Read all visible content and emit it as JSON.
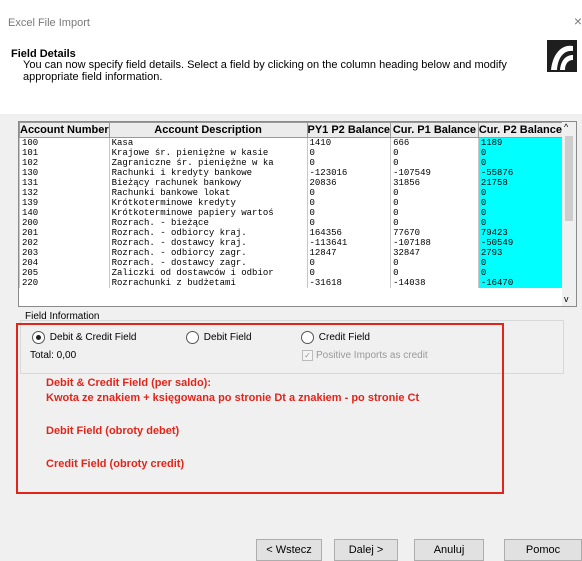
{
  "window": {
    "title": "Excel File Import",
    "close": "×"
  },
  "header": {
    "heading": "Field Details",
    "description": "You can now specify field details. Select a field by clicking on the column heading below and modify appropriate field information."
  },
  "grid": {
    "columns": [
      "Account Number",
      "Account Description",
      "PY1 P2 Balance",
      "Cur. P1 Balance",
      "Cur. P2 Balance"
    ],
    "highlight_color": "#00ffff",
    "rows": [
      [
        "100",
        "Kasa",
        "1410",
        "666",
        "1189"
      ],
      [
        "101",
        "Krajowe śr. pieniężne w kasie",
        "0",
        "0",
        "0"
      ],
      [
        "102",
        "Zagraniczne śr. pieniężne w ka",
        "0",
        "0",
        "0"
      ],
      [
        "130",
        "Rachunki i kredyty bankowe",
        "-123016",
        "-107549",
        "-55876"
      ],
      [
        "131",
        "Bieżący rachunek bankowy",
        "20836",
        "31856",
        "21758"
      ],
      [
        "132",
        "Rachunki bankowe lokat",
        "0",
        "0",
        "0"
      ],
      [
        "139",
        "Krótkoterminowe kredyty",
        "0",
        "0",
        "0"
      ],
      [
        "140",
        "Krótkoterminowe papiery wartoś",
        "0",
        "0",
        "0"
      ],
      [
        "200",
        "Rozrach. - bieżące",
        "0",
        "0",
        "0"
      ],
      [
        "201",
        "Rozrach. - odbiorcy kraj.",
        "164356",
        "77670",
        "79423"
      ],
      [
        "202",
        "Rozrach. - dostawcy kraj.",
        "-113641",
        "-107188",
        "-50549"
      ],
      [
        "203",
        "Rozrach. - odbiorcy zagr.",
        "12847",
        "32847",
        "2793"
      ],
      [
        "204",
        "Rozrach. - dostawcy zagr.",
        "0",
        "0",
        "0"
      ],
      [
        "205",
        "Zaliczki od dostawców i odbior",
        "0",
        "0",
        "0"
      ],
      [
        "220",
        "Rozrachunki z budżetami",
        "-31618",
        "-14038",
        "-16470"
      ]
    ]
  },
  "field_info": {
    "label": "Field Information",
    "radio_debit_credit": "Debit & Credit Field",
    "radio_debit": "Debit Field",
    "radio_credit": "Credit Field",
    "total": "Total: 0,00",
    "positive_imports": "Positive Imports as credit"
  },
  "notes": {
    "line1": "Debit & Credit Field (per saldo):",
    "line2": "Kwota ze znakiem + księgowana po stronie Dt a znakiem - po stronie Ct",
    "line3": "Debit Field (obroty debet)",
    "line4": "Credit Field (obroty credit)"
  },
  "buttons": {
    "back": "< Wstecz",
    "next": "Dalej >",
    "cancel": "Anuluj",
    "help": "Pomoc"
  }
}
